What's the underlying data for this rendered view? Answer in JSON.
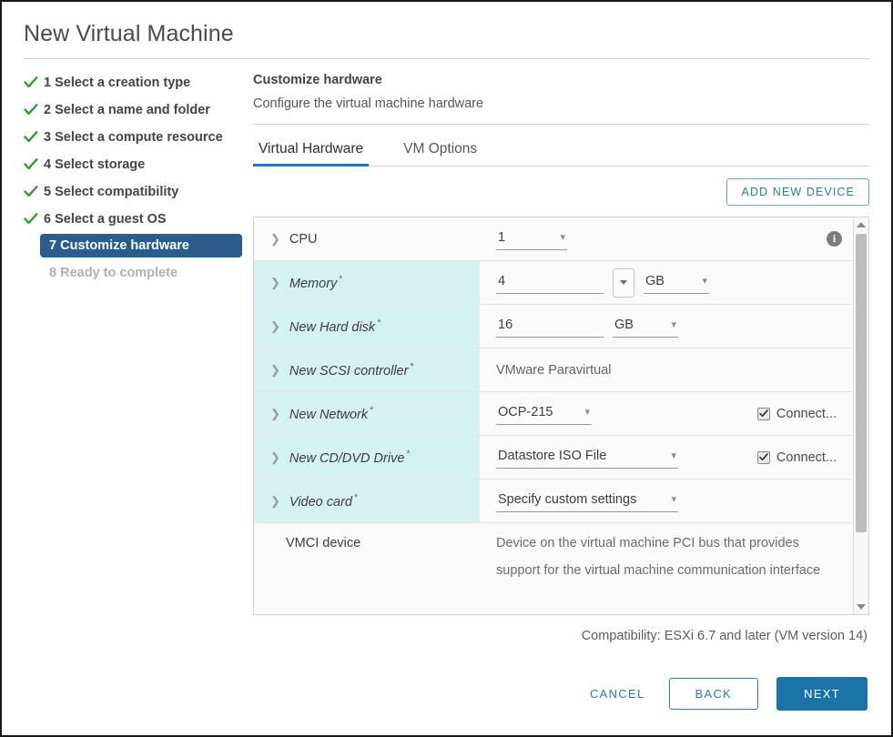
{
  "window": {
    "title": "New Virtual Machine"
  },
  "steps": [
    {
      "num": "1",
      "label": "1 Select a creation type",
      "state": "done"
    },
    {
      "num": "2",
      "label": "2 Select a name and folder",
      "state": "done"
    },
    {
      "num": "3",
      "label": "3 Select a compute resource",
      "state": "done"
    },
    {
      "num": "4",
      "label": "4 Select storage",
      "state": "done"
    },
    {
      "num": "5",
      "label": "5 Select compatibility",
      "state": "done"
    },
    {
      "num": "6",
      "label": "6 Select a guest OS",
      "state": "done"
    },
    {
      "num": "7",
      "label": "7 Customize hardware",
      "state": "current"
    },
    {
      "num": "8",
      "label": "8 Ready to complete",
      "state": "pending"
    }
  ],
  "content": {
    "heading": "Customize hardware",
    "subheading": "Configure the virtual machine hardware",
    "tabs": [
      {
        "label": "Virtual Hardware",
        "active": true
      },
      {
        "label": "VM Options",
        "active": false
      }
    ],
    "add_device_label": "ADD NEW DEVICE"
  },
  "hardware": {
    "cpu": {
      "name": "CPU",
      "value": "1",
      "info_glyph": "i"
    },
    "memory": {
      "name": "Memory",
      "required": "*",
      "value": "4",
      "unit": "GB"
    },
    "hard_disk": {
      "name": "New Hard disk",
      "required": "*",
      "value": "16",
      "unit": "GB"
    },
    "scsi_controller": {
      "name": "New SCSI controller",
      "required": "*",
      "value": "VMware Paravirtual"
    },
    "network": {
      "name": "New Network",
      "required": "*",
      "value": "OCP-215",
      "connect_label": "Connect...",
      "connect_checked": true
    },
    "cddvd": {
      "name": "New CD/DVD Drive",
      "required": "*",
      "value": "Datastore ISO File",
      "connect_label": "Connect...",
      "connect_checked": true
    },
    "video_card": {
      "name": "Video card",
      "required": "*",
      "value": "Specify custom settings"
    },
    "vmci": {
      "name": "VMCI device",
      "description": "Device on the virtual machine PCI bus that provides support for the virtual machine communication interface"
    }
  },
  "footer": {
    "compatibility": "Compatibility: ESXi 6.7 and later (VM version 14)",
    "cancel_label": "CANCEL",
    "back_label": "BACK",
    "next_label": "NEXT"
  },
  "colors": {
    "accent_blue": "#1b7bbb",
    "primary_button": "#1b74a8",
    "step_current_bg": "#2b5d8c",
    "check_green": "#2d9e2d",
    "row_highlight": "#d6f2f0"
  }
}
